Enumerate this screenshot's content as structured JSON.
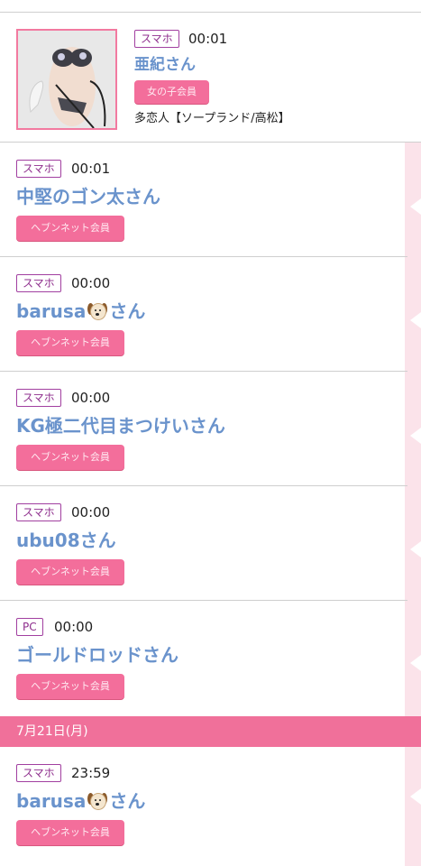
{
  "featured": {
    "device": "スマホ",
    "time": "00:01",
    "name": "亜紀さん",
    "member_label": "女の子会員",
    "shop": "多恋人【ソープランド/高松】"
  },
  "entries": [
    {
      "device": "スマホ",
      "time": "00:01",
      "name": "中堅のゴン太さん",
      "member_label": "ヘブンネット会員"
    },
    {
      "device": "スマホ",
      "time": "00:00",
      "name_prefix": "barusa",
      "name_suffix": "さん",
      "emoji": "dog-face-icon",
      "member_label": "ヘブンネット会員"
    },
    {
      "device": "スマホ",
      "time": "00:00",
      "name": "KG極二代目まつけいさん",
      "member_label": "ヘブンネット会員"
    },
    {
      "device": "スマホ",
      "time": "00:00",
      "name": "ubu08さん",
      "member_label": "ヘブンネット会員"
    },
    {
      "device": "PC",
      "time": "00:00",
      "name": "ゴールドロッドさん",
      "member_label": "ヘブンネット会員"
    },
    {
      "device": "スマホ",
      "time": "23:59",
      "name_prefix": "barusa",
      "name_suffix": "さん",
      "emoji": "dog-face-icon",
      "member_label": "ヘブンネット会員"
    }
  ],
  "date_separator": "7月21日(月)",
  "colors": {
    "accent_pink": "#f36e9b",
    "date_bar": "#f0709a",
    "name_blue": "#6a93cc",
    "device_border": "#a13fa0",
    "side_strip": "#fbe3ea"
  }
}
